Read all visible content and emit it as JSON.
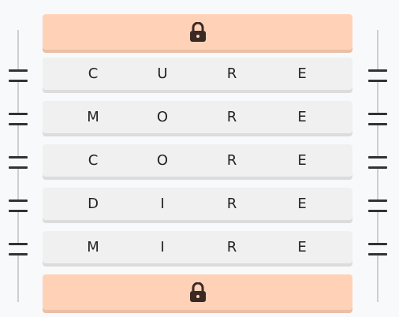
{
  "puzzle": {
    "rows": [
      {
        "letters": [
          "C",
          "U",
          "R",
          "E"
        ]
      },
      {
        "letters": [
          "M",
          "O",
          "R",
          "E"
        ]
      },
      {
        "letters": [
          "C",
          "O",
          "R",
          "E"
        ]
      },
      {
        "letters": [
          "D",
          "I",
          "R",
          "E"
        ]
      },
      {
        "letters": [
          "M",
          "I",
          "R",
          "E"
        ]
      }
    ]
  },
  "icons": {
    "lock": "lock-icon",
    "handle": "drag-handle-icon"
  },
  "colors": {
    "background": "#f8f9fa",
    "locked_row": "#ffd2b8",
    "word_row": "#f0f0f0",
    "text": "#222222"
  }
}
